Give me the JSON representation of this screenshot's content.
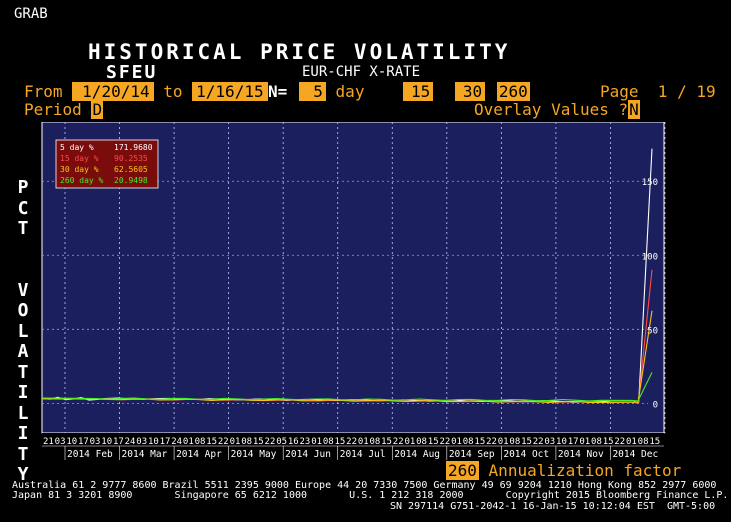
{
  "screen": {
    "grab": "GRAB",
    "title": "HISTORICAL PRICE VOLATILITY",
    "ticker": "SFEU",
    "security": "EUR-CHF X-RATE",
    "from_label": "From",
    "from_date": "1/20/14",
    "to_label": "to",
    "to_date": "1/16/15",
    "n_label": "N=",
    "n_value": "5",
    "n_unit": "day",
    "n2": "15",
    "n3": "30",
    "n4": "260",
    "page_label": "Page",
    "page_value": "1 / 19",
    "period_label": "Period",
    "period_value": "D",
    "overlay_label": "Overlay Values ?",
    "overlay_value": "N",
    "ylabel_vertical": "PCT  VOLATILITY",
    "annualization_value": "260",
    "annualization_label": "Annualization factor"
  },
  "footer": {
    "line1": "Australia 61 2 9777 8600 Brazil 5511 2395 9000 Europe 44 20 7330 7500 Germany 49 69 9204 1210 Hong Kong 852 2977 6000",
    "line2": "Japan 81 3 3201 8900       Singapore 65 6212 1000       U.S. 1 212 318 2000       Copyright 2015 Bloomberg Finance L.P.",
    "line3": "SN 297114 G751-2042-1 16-Jan-15 10:12:04 EST  GMT-5:00"
  },
  "colors": {
    "plot_bg": "#1b1f5e",
    "amber": "#f5a623",
    "s5": "#ffffff",
    "s15": "#ff4a4a",
    "s30": "#ffc21a",
    "s260": "#44ee22"
  },
  "chart_data": {
    "type": "line",
    "title": "HISTORICAL PRICE VOLATILITY",
    "ylabel": "PCT VOLATILITY",
    "ylim": [
      -20,
      190
    ],
    "yticks": [
      0,
      50,
      100,
      150
    ],
    "grid": true,
    "legend_placement": "top-left",
    "x_start": "2014-01-20",
    "x_end": "2015-01-16",
    "day_ticks": [
      "21",
      "03",
      "10",
      "17",
      "03",
      "10",
      "17",
      "24",
      "03",
      "10",
      "17",
      "24",
      "01",
      "08",
      "15",
      "22",
      "01",
      "08",
      "15",
      "22",
      "05",
      "16",
      "23",
      "01",
      "08",
      "15",
      "22",
      "01",
      "08",
      "15",
      "22",
      "01",
      "08",
      "15",
      "22",
      "01",
      "08",
      "15",
      "22",
      "01",
      "08",
      "15",
      "22",
      "03",
      "10",
      "17",
      "01",
      "08",
      "15",
      "22",
      "01",
      "08",
      "15"
    ],
    "month_labels": [
      "2014 Feb",
      "2014 Mar",
      "2014 Apr",
      "2014 May",
      "2014 Jun",
      "2014 Jul",
      "2014 Aug",
      "2014 Sep",
      "2014 Oct",
      "2014 Nov",
      "2014 Dec"
    ],
    "series": [
      {
        "name": "5  day %",
        "last_value": "171.9680",
        "values_start": [
          3.5,
          2.8,
          4.1,
          2.5,
          3.0,
          3.9,
          2.2,
          2.7,
          3.3
        ],
        "values_end": [
          1.0,
          0.6,
          1.2,
          0.4,
          0.5,
          0.8,
          171.968
        ]
      },
      {
        "name": "15 day %",
        "last_value": "90.2535",
        "values_start": [
          3.2,
          3.0,
          3.1,
          2.9,
          3.0
        ],
        "values_end": [
          0.9,
          0.8,
          0.7,
          0.6,
          0.6,
          90.2535
        ]
      },
      {
        "name": "30 day %",
        "last_value": "62.5605",
        "values_start": [
          3.1,
          3.0,
          3.0,
          2.9
        ],
        "values_end": [
          0.8,
          0.8,
          0.7,
          0.7,
          62.5605
        ]
      },
      {
        "name": "260 day %",
        "last_value": "20.9498",
        "values_start": [
          3.6,
          3.5,
          3.4,
          3.3
        ],
        "values_end": [
          2.0,
          1.9,
          1.8,
          1.7,
          20.9498
        ]
      }
    ]
  }
}
